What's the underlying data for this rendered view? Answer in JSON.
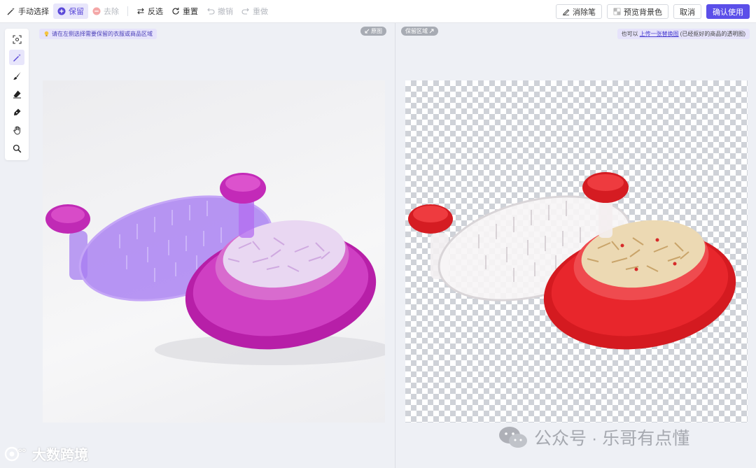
{
  "toolbar": {
    "manual_select": "手动选择",
    "keep": "保留",
    "remove": "去除",
    "invert": "反选",
    "reset": "重置",
    "undo": "撤销",
    "redo": "重做",
    "eraser_pen": "消除笔",
    "preview_bg": "预览背景色",
    "cancel": "取消",
    "confirm": "确认使用"
  },
  "tools": [
    "select-region",
    "magic-wand",
    "brush",
    "eraser",
    "pen",
    "hand",
    "zoom"
  ],
  "left_pane": {
    "hint": "请在左侧选择需要保留的衣服或商品区域",
    "badge": "原图"
  },
  "right_pane": {
    "badge": "保留区域",
    "hint_prefix": "也可以",
    "hint_link": "上传一张替换图",
    "hint_suffix": "(已经抠好的商品的透明图)"
  },
  "watermark": {
    "left": "大数跨境",
    "right": "公众号 · 乐哥有点懂"
  },
  "colors": {
    "accent": "#5b4fe9",
    "highlight_bg": "#e8e6fb",
    "mask_purple": "#9b6cf0",
    "mask_magenta": "#c22fc0",
    "product_red": "#e8242b"
  }
}
